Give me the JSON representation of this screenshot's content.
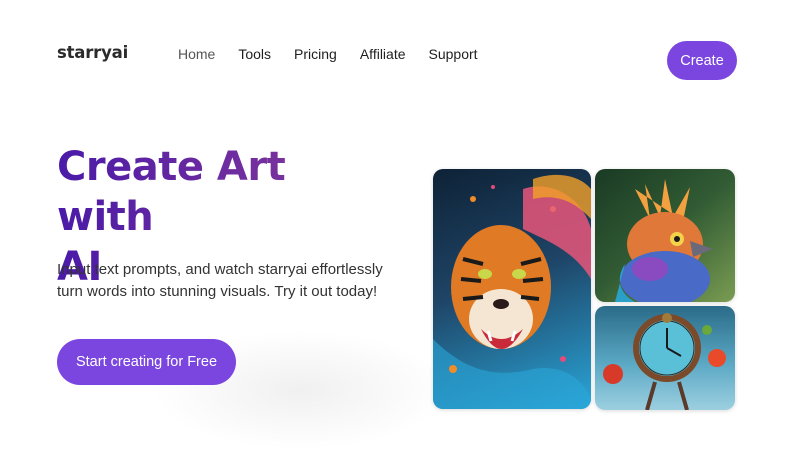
{
  "brand": {
    "logo_text": "starryai"
  },
  "nav": {
    "items": [
      {
        "label": "Home"
      },
      {
        "label": "Tools"
      },
      {
        "label": "Pricing"
      },
      {
        "label": "Affiliate"
      },
      {
        "label": "Support"
      }
    ],
    "create_label": "Create"
  },
  "hero": {
    "title_line1": "Create Art with",
    "title_line2": "AI",
    "subtitle": "Input text prompts, and watch starryai effortlessly turn words into stunning visuals. Try it out today!",
    "cta_label": "Start creating for Free"
  },
  "colors": {
    "accent": "#7b45e0",
    "title_gradient_start": "#4a1aa8",
    "title_gradient_end": "#8a3a9a"
  },
  "gallery": {
    "images": [
      {
        "subject": "tiger-artwork"
      },
      {
        "subject": "bird-artwork"
      },
      {
        "subject": "clock-artwork"
      }
    ]
  }
}
